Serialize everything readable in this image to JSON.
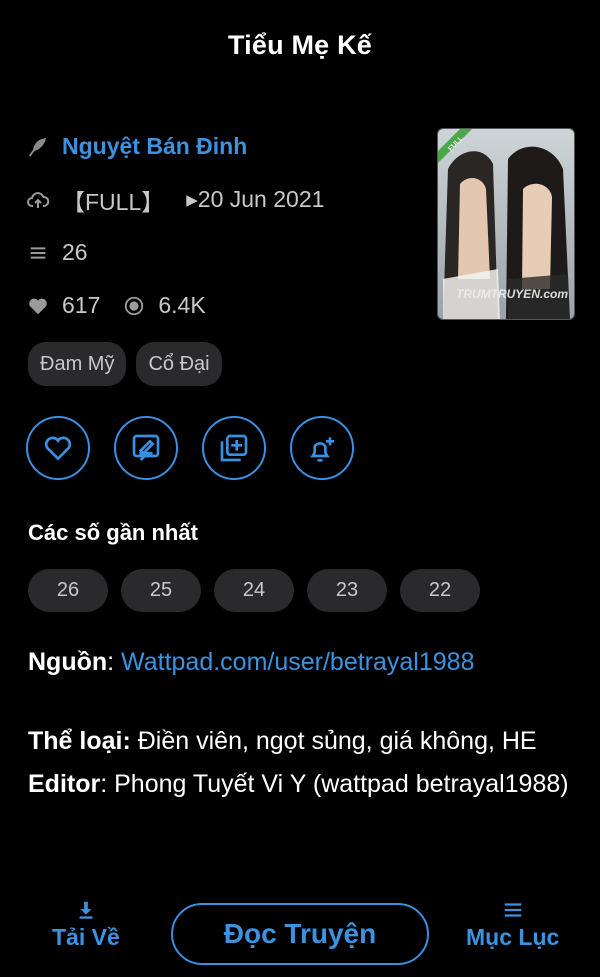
{
  "header": {
    "title": "Tiểu Mẹ Kế"
  },
  "info": {
    "author": "Nguyệt Bán Đinh",
    "status": "【FULL】",
    "updated": "▸20 Jun 2021",
    "chapters": "26",
    "likes": "617",
    "views": "6.4K"
  },
  "cover": {
    "badge": "FULL",
    "watermark": "TRUMTRUYEN.com"
  },
  "tags": [
    "Đam Mỹ",
    "Cổ Đại"
  ],
  "recent": {
    "title": "Các số gần nhất",
    "chapters": [
      "26",
      "25",
      "24",
      "23",
      "22"
    ]
  },
  "description": {
    "source_label": "Nguồn",
    "source_sep": ": ",
    "source_link": "Wattpad.com/user/betrayal1988",
    "genre_label": "Thể loại:",
    "genre_value": " Điền viên, ngọt sủng, giá không, HE",
    "editor_label": "Editor",
    "editor_value": ": Phong Tuyết Vi Y (wattpad betrayal1988)"
  },
  "bottom": {
    "download_label": "Tải Về",
    "read_label": "Đọc Truyện",
    "toc_label": "Mục Lục"
  },
  "colors": {
    "accent": "#3b93e0",
    "background": "#000000",
    "chip": "#2a2a2c"
  }
}
